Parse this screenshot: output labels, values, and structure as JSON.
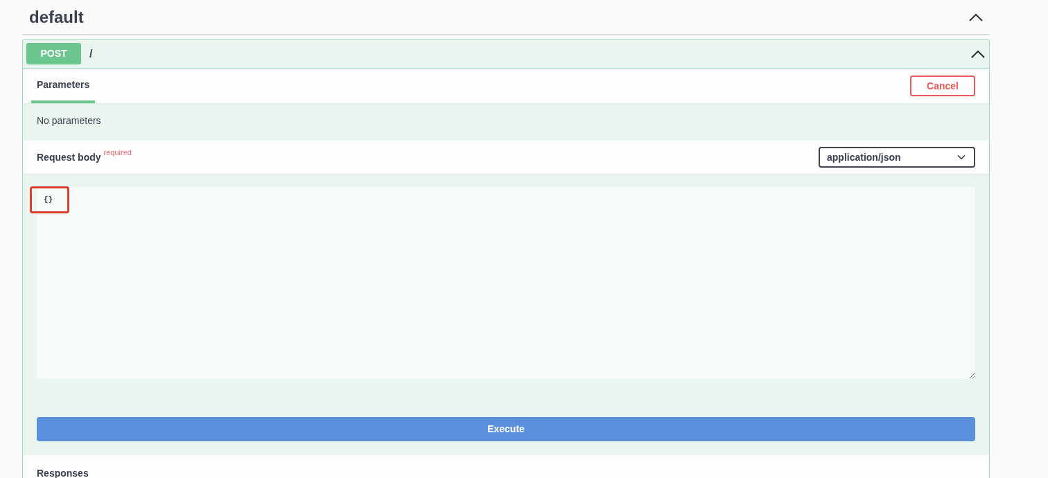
{
  "section": {
    "title": "default",
    "expanded": true
  },
  "operation": {
    "method": "POST",
    "path": "/",
    "expanded": true
  },
  "tabs": [
    {
      "label": "Parameters",
      "selected": true
    }
  ],
  "cancel_button": "Cancel",
  "parameters_message": "No parameters",
  "request_body": {
    "label": "Request body",
    "required_text": "required",
    "content_type": "application/json",
    "value": "{}"
  },
  "execute_button": "Execute",
  "responses_title": "Responses"
}
